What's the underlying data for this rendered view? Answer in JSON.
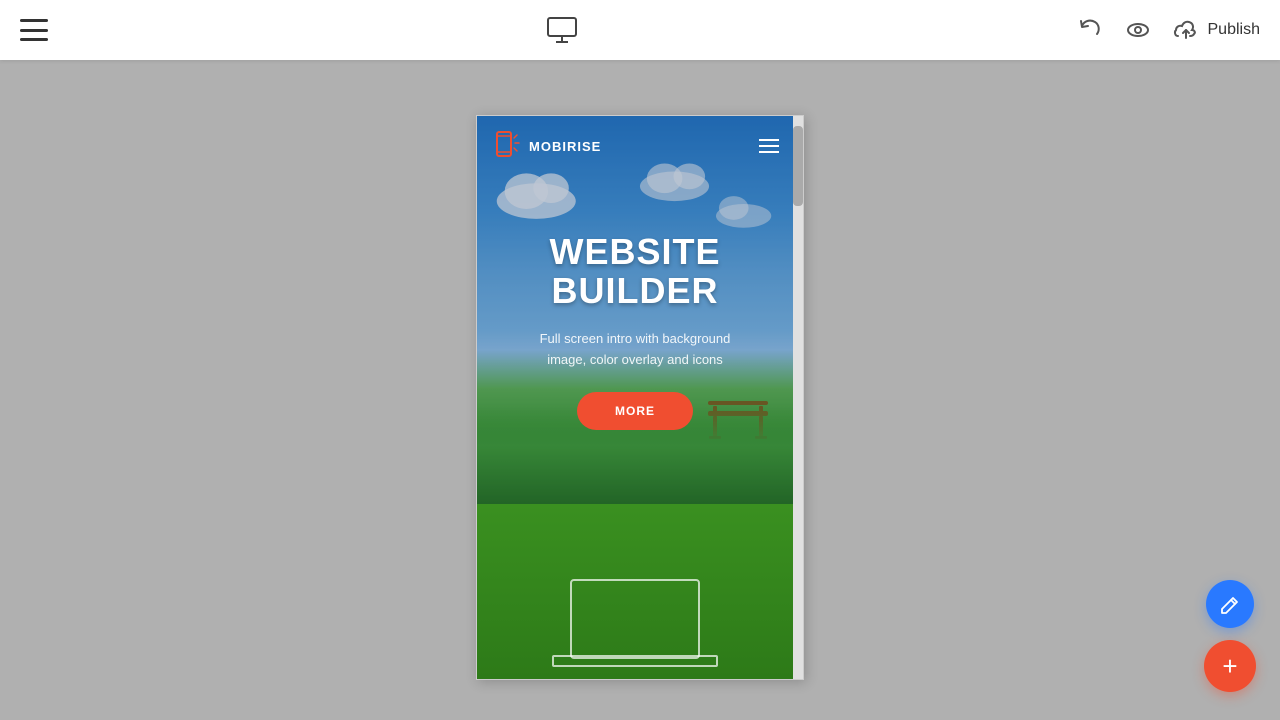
{
  "toolbar": {
    "menu_icon": "hamburger-icon",
    "preview_icon": "monitor-icon",
    "undo_icon": "undo-icon",
    "eye_icon": "eye-icon",
    "publish_label": "Publish",
    "cloud_icon": "cloud-upload-icon"
  },
  "preview": {
    "nav": {
      "logo_text": "MOBIRISE",
      "hamburger_icon": "menu-icon"
    },
    "hero": {
      "title_line1": "WEBSITE",
      "title_line2": "BUILDER",
      "subtitle": "Full screen intro with background image, color overlay and icons",
      "more_button": "MORE"
    }
  },
  "fab": {
    "edit_icon": "pencil-icon",
    "add_icon": "+"
  }
}
